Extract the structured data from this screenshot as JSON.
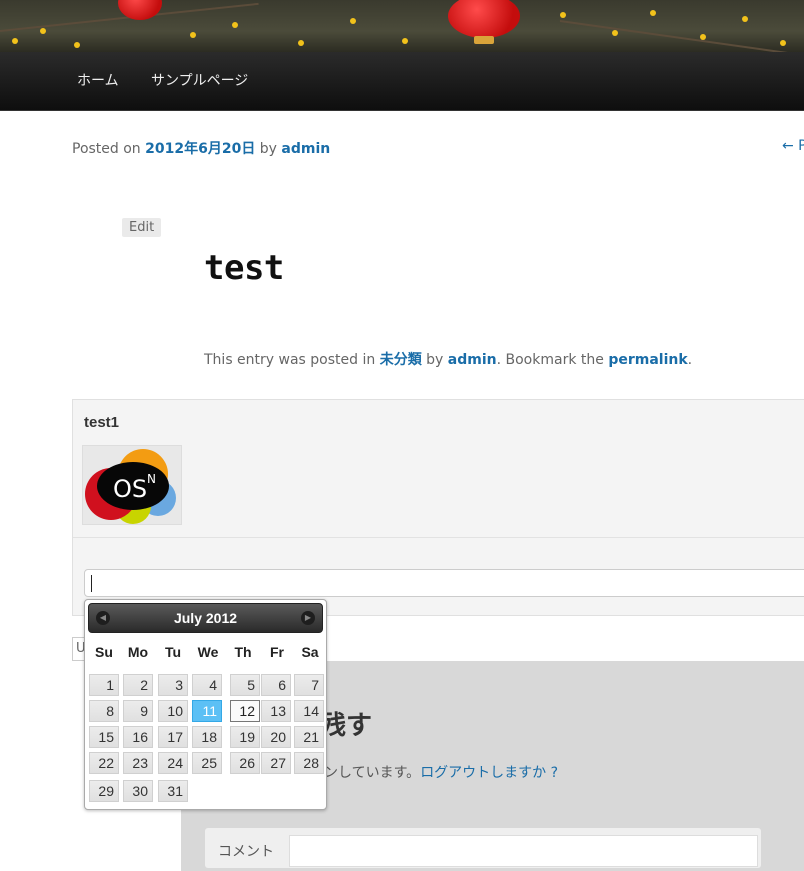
{
  "nav": {
    "items": [
      {
        "label": "ホーム"
      },
      {
        "label": "サンプルページ"
      }
    ]
  },
  "post": {
    "meta_prefix": "Posted on",
    "date": "2012年6月20日",
    "by": "by",
    "author": "admin",
    "prev_link": "← P",
    "edit_label": "Edit",
    "title": "test",
    "entry_meta": {
      "prefix": "This entry was posted in",
      "category": "未分類",
      "by": "by",
      "author": "admin",
      "bookmark": ". Bookmark the",
      "permalink": "permalink",
      "end": "."
    }
  },
  "comment": {
    "author": "test1",
    "avatar_text": "OS",
    "avatar_sup": "N",
    "small_input_text": "U"
  },
  "datepicker": {
    "title": "July 2012",
    "prev_label": "◀",
    "next_label": "▶",
    "weekdays": [
      "Su",
      "Mo",
      "Tu",
      "We",
      "Th",
      "Fr",
      "Sa"
    ],
    "selected_day": 11,
    "hover_day": 12,
    "weeks": [
      [
        1,
        2,
        3,
        4,
        5,
        6,
        7
      ],
      [
        8,
        9,
        10,
        11,
        12,
        13,
        14
      ],
      [
        15,
        16,
        17,
        18,
        19,
        20,
        21
      ],
      [
        22,
        23,
        24,
        25,
        26,
        27,
        28
      ],
      [
        29,
        30,
        31
      ]
    ]
  },
  "reply": {
    "title": "残す",
    "logged_in_text": "インしています。",
    "logout_link": "ログアウトしますか ?",
    "comment_label": "コメント"
  },
  "colors": {
    "link": "#1a6da8",
    "selected_day": "#5cc0f5",
    "nav_bg": "#111111"
  }
}
